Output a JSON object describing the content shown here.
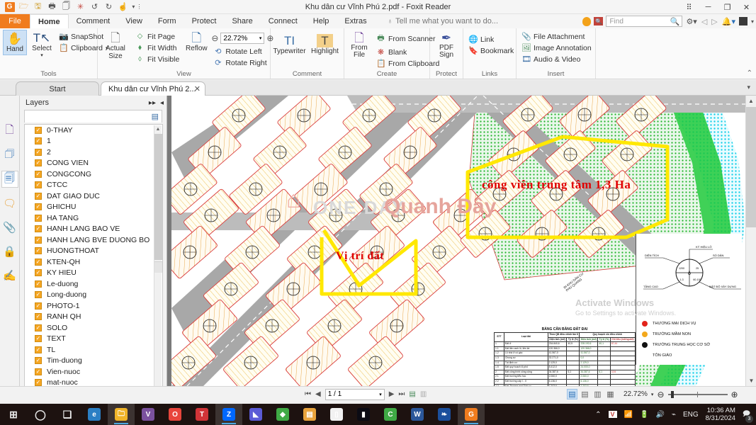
{
  "window": {
    "title": "Khu dân cư Vĩnh Phú 2.pdf - Foxit Reader",
    "quick_access": [
      "foxit-logo",
      "open-icon",
      "save-icon",
      "print-icon",
      "copy-icon",
      "new-icon",
      "undo-icon",
      "redo-icon",
      "touch-icon",
      "qat-more-icon"
    ],
    "controls": {
      "grid": "⠿",
      "minimize": "─",
      "restore": "❐",
      "close": "✕"
    }
  },
  "menu": {
    "file": "File",
    "tabs": [
      "Home",
      "Comment",
      "View",
      "Form",
      "Protect",
      "Share",
      "Connect",
      "Help",
      "Extras"
    ],
    "active_tab": "Home",
    "tellme": "Tell me what you want to do...",
    "find_placeholder": "Find",
    "right_icons": [
      "highlight-oval-icon",
      "ocr-icon",
      "find-input",
      "settings-gear-icon",
      "prev-arrow-icon",
      "next-arrow-icon",
      "bell-icon",
      "account-icon"
    ]
  },
  "ribbon": {
    "groups": [
      {
        "label": "Tools",
        "big": [
          {
            "name": "hand-tool",
            "label": "Hand",
            "glyph": "✋",
            "selected": true
          },
          {
            "name": "select-tool",
            "label": "Select",
            "glyph": "⌖",
            "selected": false
          }
        ],
        "small": [
          {
            "name": "snapshot",
            "label": "SnapShot",
            "icon": "📷"
          },
          {
            "name": "clipboard",
            "label": "Clipboard",
            "icon": "📋",
            "caret": "▾"
          }
        ]
      },
      {
        "label": "View",
        "big": [
          {
            "name": "actual-size",
            "label": "Actual Size",
            "glyph": "⬜"
          },
          {
            "name": "reflow",
            "label": "Reflow",
            "glyph": "Aᴀ"
          }
        ],
        "small": [
          {
            "name": "fit-page",
            "label": "Fit Page",
            "icon": "⬦"
          },
          {
            "name": "fit-width",
            "label": "Fit Width",
            "icon": "⬧"
          },
          {
            "name": "fit-visible",
            "label": "Fit Visible",
            "icon": "⬨"
          }
        ],
        "zoom_value": "22.72%",
        "zoom_out": "⊖",
        "zoom_in": "⊕",
        "rotate": [
          {
            "name": "rotate-left",
            "label": "Rotate Left",
            "icon": "↺"
          },
          {
            "name": "rotate-right",
            "label": "Rotate Right",
            "icon": "↻"
          }
        ]
      },
      {
        "label": "Comment",
        "big": [
          {
            "name": "typewriter",
            "label": "Typewriter",
            "glyph": "TI"
          },
          {
            "name": "highlight",
            "label": "Highlight",
            "glyph": "T"
          }
        ],
        "small": []
      },
      {
        "label": "Create",
        "big": [
          {
            "name": "from-file",
            "label": "From File",
            "glyph": "🗋"
          }
        ],
        "small": [
          {
            "name": "from-scanner",
            "label": "From Scanner",
            "icon": "🖨"
          },
          {
            "name": "blank",
            "label": "Blank",
            "icon": "❋"
          },
          {
            "name": "from-clipboard",
            "label": "From Clipboard",
            "icon": "📋"
          }
        ]
      },
      {
        "label": "Protect",
        "big": [
          {
            "name": "pdf-sign",
            "label": "PDF Sign",
            "glyph": "✎"
          }
        ],
        "small": []
      },
      {
        "label": "Links",
        "big": [],
        "small": [
          {
            "name": "link",
            "label": "Link",
            "icon": "🌐"
          },
          {
            "name": "bookmark",
            "label": "Bookmark",
            "icon": "🔖"
          }
        ]
      },
      {
        "label": "Insert",
        "big": [],
        "small": [
          {
            "name": "file-attachment",
            "label": "File Attachment",
            "icon": "📎"
          },
          {
            "name": "image-annotation",
            "label": "Image Annotation",
            "icon": "🖼"
          },
          {
            "name": "audio-video",
            "label": "Audio & Video",
            "icon": "🎞"
          }
        ]
      }
    ],
    "collapse": "⌃"
  },
  "doctabs": {
    "start": "Start",
    "document": "Khu dân cư Vĩnh Phú 2...",
    "close": "✕",
    "overflow_caret": "▾"
  },
  "rail": [
    {
      "name": "sidebar-page-thumbnails",
      "glyph": "🗋"
    },
    {
      "name": "sidebar-bookmarks",
      "glyph": "🗇"
    },
    {
      "name": "sidebar-layers",
      "glyph": "🗐",
      "selected": true
    },
    {
      "name": "sidebar-comments",
      "glyph": "🗨"
    },
    {
      "name": "sidebar-attachments",
      "glyph": "📎"
    },
    {
      "name": "sidebar-security",
      "glyph": "🔒"
    },
    {
      "name": "sidebar-signatures",
      "glyph": "✍"
    }
  ],
  "layers": {
    "title": "Layers",
    "expand_icon": "▸▸",
    "collapse_icon": "◂",
    "options_icon": "▤",
    "items": [
      "0-THAY",
      "1",
      "2",
      "CONG VIEN",
      "CONGCONG",
      "CTCC",
      "DAT GIAO DUC",
      "GHICHU",
      "HA TANG",
      "HANH LANG BAO VE",
      "HANH LANG BVE DUONG BO",
      "HUONGTHOAT",
      "KTEN-QH",
      "KY HIEU",
      "Le-duong",
      "Long-duong",
      "PHOTO-1",
      "RANH QH",
      "SOLO",
      "TEXT",
      "TL",
      "Tim-duong",
      "Vien-nuoc",
      "mat-nuoc"
    ],
    "scroll_up": "▲",
    "scroll_down": "▼"
  },
  "map": {
    "annotations": [
      {
        "name": "park-annotation",
        "text": "công viên trung tâm 1,3 Ha"
      },
      {
        "name": "land-position-annotation",
        "text": "Vị trí đất"
      }
    ],
    "watermark": {
      "line1": "ONE DAY",
      "line2": "Quanh Đây"
    },
    "legend": {
      "symbol_labels": {
        "top": "KÝ HIỆU LÔ",
        "left": "DIỆN TÍCH",
        "right": "SỐ DÂN",
        "bottom_left": "TẦNG CAO",
        "bottom_right": "MẬT ĐỘ XÂY DỰNG"
      },
      "items": [
        {
          "label": "THƯƠNG MẠI DỊCH VỤ",
          "color": "#e2231a"
        },
        {
          "label": "TRƯỜNG MẦM NON",
          "color": "#f3a81c"
        },
        {
          "label": "TRƯỜNG TRUNG HỌC CƠ SỞ",
          "color": "#111111"
        },
        {
          "label": "TÔN GIÁO",
          "color": "#ffffff"
        }
      ]
    },
    "table": {
      "title": "BẢNG CÂN BẰNG ĐẤT ĐAI",
      "group_headers": [
        "STT",
        "Loại đất",
        "Theo QĐ điều chỉnh lần 6",
        "Quy hoạch xin điều chỉnh"
      ],
      "columns": [
        "STT",
        "Loại đất",
        "Diện tích (m2)",
        "Tỷ lệ (%)",
        "Diện tích (m2)",
        "Tỷ lệ (%)",
        "Chỉ tiêu (m2/người)"
      ],
      "rows": [
        [
          "1",
          "Đất ở",
          "234.840,6",
          "40,5",
          "228.192,6",
          "40,1",
          "87,44"
        ],
        [
          "1.1",
          "Đất liên ranh lô, liên kề",
          "120.366,0",
          "",
          "120.366,0",
          "",
          ""
        ],
        [
          "1.2",
          "Lô nhà ở có gác",
          "41.567,0",
          "",
          "41.567,0",
          "",
          ""
        ],
        [
          "1.3",
          "Chung cư",
          "32.271,0",
          "",
          "0,0",
          "",
          ""
        ],
        [
          "1.4",
          "Tái định cư",
          "2.129,0",
          "",
          "2.129,0",
          "",
          ""
        ],
        [
          "1.5",
          "Đất quy hoạch lô phố",
          "8.412,0",
          "",
          "24.000,0",
          "",
          ""
        ],
        [
          "2",
          "Đất công trình công cộng",
          "34.387,6",
          "6,1",
          "34.387,6",
          "6,1",
          "3,94"
        ],
        [
          "2.1",
          "Đất trường tiểu học",
          "2.060,0",
          "",
          "2.060,0",
          "",
          ""
        ],
        [
          "2.2",
          "Đất trường cấp I - II",
          "6.136,0",
          "",
          "6.136,0",
          "",
          ""
        ],
        [
          "2.3",
          "Đất Thương mại Dịch vụ",
          "7.203,6",
          "",
          "7.203,6",
          "",
          ""
        ]
      ]
    }
  },
  "status": {
    "first_page": "⏮",
    "prev_page": "◀",
    "page_value": "1 / 1",
    "page_caret": "▾",
    "next_page": "▶",
    "last_page": "⏭",
    "tools": [
      "split-view-icon",
      "compare-icon"
    ],
    "view_modes": [
      "single-page-icon",
      "continuous-icon",
      "facing-icon",
      "facing-continuous-icon"
    ],
    "zoom_value": "22.72%",
    "zoom_caret": "▾",
    "zoom_out": "⊖",
    "zoom_in": "⊕"
  },
  "taskbar": {
    "items": [
      {
        "name": "start-button",
        "glyph": "⊞",
        "color": "transparent"
      },
      {
        "name": "cortana-search",
        "glyph": "◯",
        "color": "transparent"
      },
      {
        "name": "task-view",
        "glyph": "❏",
        "color": "transparent"
      },
      {
        "name": "edge-browser",
        "glyph": "e",
        "color": "#2b7fc4"
      },
      {
        "name": "file-explorer",
        "glyph": "🗀",
        "color": "#f0b429",
        "active": true
      },
      {
        "name": "viber",
        "glyph": "V",
        "color": "#7b519d"
      },
      {
        "name": "chrome",
        "glyph": "O",
        "color": "#e8453c"
      },
      {
        "name": "unikey",
        "glyph": "T",
        "color": "#d13438"
      },
      {
        "name": "zalo",
        "glyph": "Z",
        "color": "#0068ff",
        "active": true
      },
      {
        "name": "bluezone",
        "glyph": "◣",
        "color": "#5b5bd6"
      },
      {
        "name": "app-green",
        "glyph": "◆",
        "color": "#3faa45"
      },
      {
        "name": "notepad-doc",
        "glyph": "▤",
        "color": "#e8a33d"
      },
      {
        "name": "text-editor",
        "glyph": "▯",
        "color": "#f2f2f2"
      },
      {
        "name": "terminal",
        "glyph": "▮",
        "color": "#0b0b14"
      },
      {
        "name": "coccoc-browser",
        "glyph": "C",
        "color": "#3faa45"
      },
      {
        "name": "word",
        "glyph": "W",
        "color": "#2b579a"
      },
      {
        "name": "butterfly-app",
        "glyph": "❧",
        "color": "#1b4f9c"
      },
      {
        "name": "foxit-reader",
        "glyph": "G",
        "color": "#f07c1e",
        "active": true
      }
    ],
    "tray": {
      "expand": "⌃",
      "icons": [
        {
          "name": "unikey-tray-icon",
          "glyph": "V"
        },
        {
          "name": "wifi-icon",
          "glyph": "📶"
        },
        {
          "name": "battery-icon",
          "glyph": "🔋"
        },
        {
          "name": "volume-icon",
          "glyph": "🔊"
        },
        {
          "name": "bluetooth-icon",
          "glyph": "⌁"
        }
      ],
      "language": "ENG",
      "time": "10:36 AM",
      "date": "8/31/2024",
      "notification_count": "3"
    }
  }
}
